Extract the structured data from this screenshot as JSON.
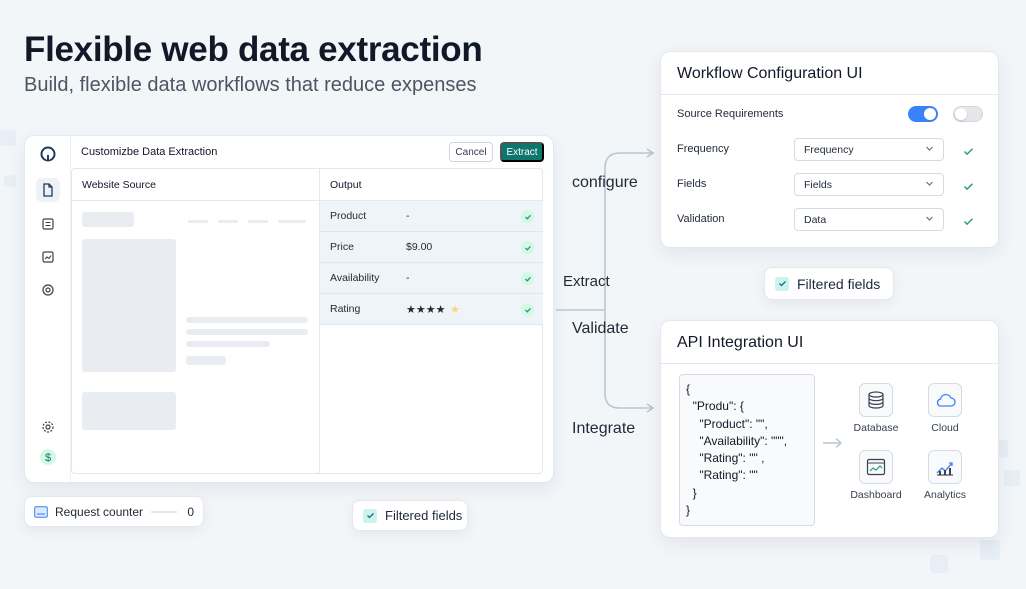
{
  "hero": {
    "title": "Flexible web data extraction",
    "subtitle": "Build, flexible data workflows that reduce expenses"
  },
  "app": {
    "title": "Customizbe Data Extraction",
    "cancel_label": "Cancel",
    "extract_label": "Extract",
    "rail_icons": [
      "logo-icon",
      "document-icon",
      "list-icon",
      "chart-icon",
      "target-icon",
      "settings-icon",
      "dollar-icon"
    ],
    "source_header": "Website Source",
    "output_header": "Output",
    "output_rows": [
      {
        "label": "Product",
        "value": "-"
      },
      {
        "label": "Price",
        "value": "$9.00"
      },
      {
        "label": "Availability",
        "value": "-"
      },
      {
        "label": "Rating",
        "value": "★★★★",
        "rating": 4.5
      }
    ]
  },
  "counter": {
    "label": "Request counter",
    "value": "0"
  },
  "filtered_pill_1": {
    "label": "Filtered fields"
  },
  "filtered_pill_2": {
    "label": "Filtered fields"
  },
  "flow": {
    "configure": "configure",
    "extract": "Extract",
    "validate": "Validate",
    "integrate": "Integrate"
  },
  "workflow": {
    "title": "Workflow Configuration UI",
    "source_requirements": "Source Requirements",
    "toggle_1_on": true,
    "toggle_2_on": false,
    "rows": [
      {
        "label": "Frequency",
        "value": "Frequency"
      },
      {
        "label": "Fields",
        "value": "Fields"
      },
      {
        "label": "Validation",
        "value": "Data"
      }
    ]
  },
  "api": {
    "title": "API Integration UI",
    "code": "{\n  \"Produ\": {\n    \"Product\": \"\",\n    \"Availability\": \"\"\",\n    \"Rating\": \"\" ,\n    \"Rating\": \"\"\n  }\n}",
    "targets": [
      {
        "label": "Database",
        "icon": "database-icon"
      },
      {
        "label": "Cloud",
        "icon": "cloud-icon"
      },
      {
        "label": "Dashboard",
        "icon": "dashboard-icon"
      },
      {
        "label": "Analytics",
        "icon": "analytics-icon"
      }
    ]
  },
  "colors": {
    "accent": "#0f766e",
    "toggle_on": "#3b82f6",
    "check_green": "#22a06b",
    "star": "#f5b301"
  }
}
